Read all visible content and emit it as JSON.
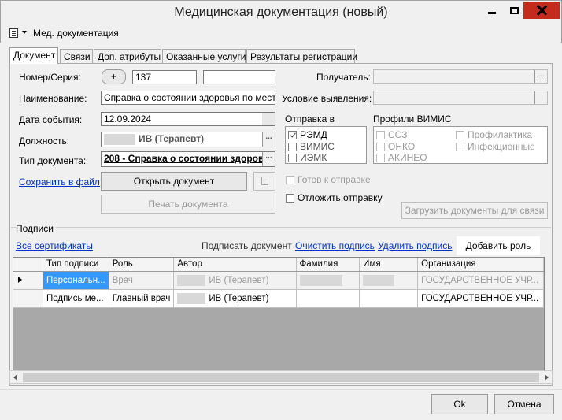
{
  "window": {
    "title": "Медицинская документация (новый)"
  },
  "menu": {
    "label": "Мед. документация"
  },
  "tabs": [
    {
      "label": "Документ"
    },
    {
      "label": "Связи"
    },
    {
      "label": "Доп. атрибуты"
    },
    {
      "label": "Оказанные услуги"
    },
    {
      "label": "Результаты регистрации"
    }
  ],
  "form": {
    "number_label": "Номер/Серия:",
    "plus_label": "+",
    "number_value": "137",
    "series_value": "",
    "name_label": "Наименование:",
    "name_value": "Справка о состоянии здоровья по месту тр",
    "event_date_label": "Дата события:",
    "event_date_value": "12.09.2024",
    "position_label": "Должность:",
    "position_value": "ИВ (Терапевт)",
    "doc_type_label": "Тип документа:",
    "doc_type_value": "208 - Справка о состоянии здоров",
    "save_file_link": "Сохранить в файл",
    "open_doc_button": "Открыть документ",
    "print_doc_button": "Печать документа",
    "recipient_label": "Получатель:",
    "recipient_value": "",
    "detection_label": "Условие выявления:",
    "detection_value": "",
    "send_to_label": "Отправка в",
    "send_to_items": [
      {
        "label": "РЭМД",
        "checked": true
      },
      {
        "label": "ВИМИС",
        "checked": false
      },
      {
        "label": "ИЭМК",
        "checked": false
      }
    ],
    "vimis_label": "Профили ВИМИС",
    "vimis_items_col1": [
      {
        "label": "ССЗ",
        "checked": false
      },
      {
        "label": "ОНКО",
        "checked": false
      },
      {
        "label": "АКИНЕО",
        "checked": false
      }
    ],
    "vimis_items_col2": [
      {
        "label": "Профилактика",
        "checked": false
      },
      {
        "label": "Инфекционные",
        "checked": false
      }
    ],
    "ready_label": "Готов к отправке",
    "postpone_label": "Отложить отправку",
    "load_docs_button": "Загрузить документы для связи"
  },
  "signatures": {
    "group_label": "Подписи",
    "all_certs_link": "Все сертификаты",
    "sign_doc_label": "Подписать документ",
    "clear_sign_link": "Очистить подпись",
    "delete_sign_link": "Удалить подпись",
    "add_role_button": "Добавить роль",
    "columns": [
      "Тип подписи",
      "Роль",
      "Автор",
      "Фамилия",
      "Имя",
      "Организация"
    ],
    "rows": [
      {
        "type": "Персональн...",
        "role": "Врач",
        "author": "ИВ (Терапевт)",
        "surname": "",
        "name": "",
        "org": "ГОСУДАРСТВЕННОЕ УЧР..."
      },
      {
        "type": "Подпись ме...",
        "role": "Главный врач",
        "author": "ИВ (Терапевт)",
        "surname": "",
        "name": "",
        "org": "ГОСУДАРСТВЕННОЕ УЧР..."
      }
    ]
  },
  "footer": {
    "ok_button": "Ok",
    "cancel_button": "Отмена"
  }
}
